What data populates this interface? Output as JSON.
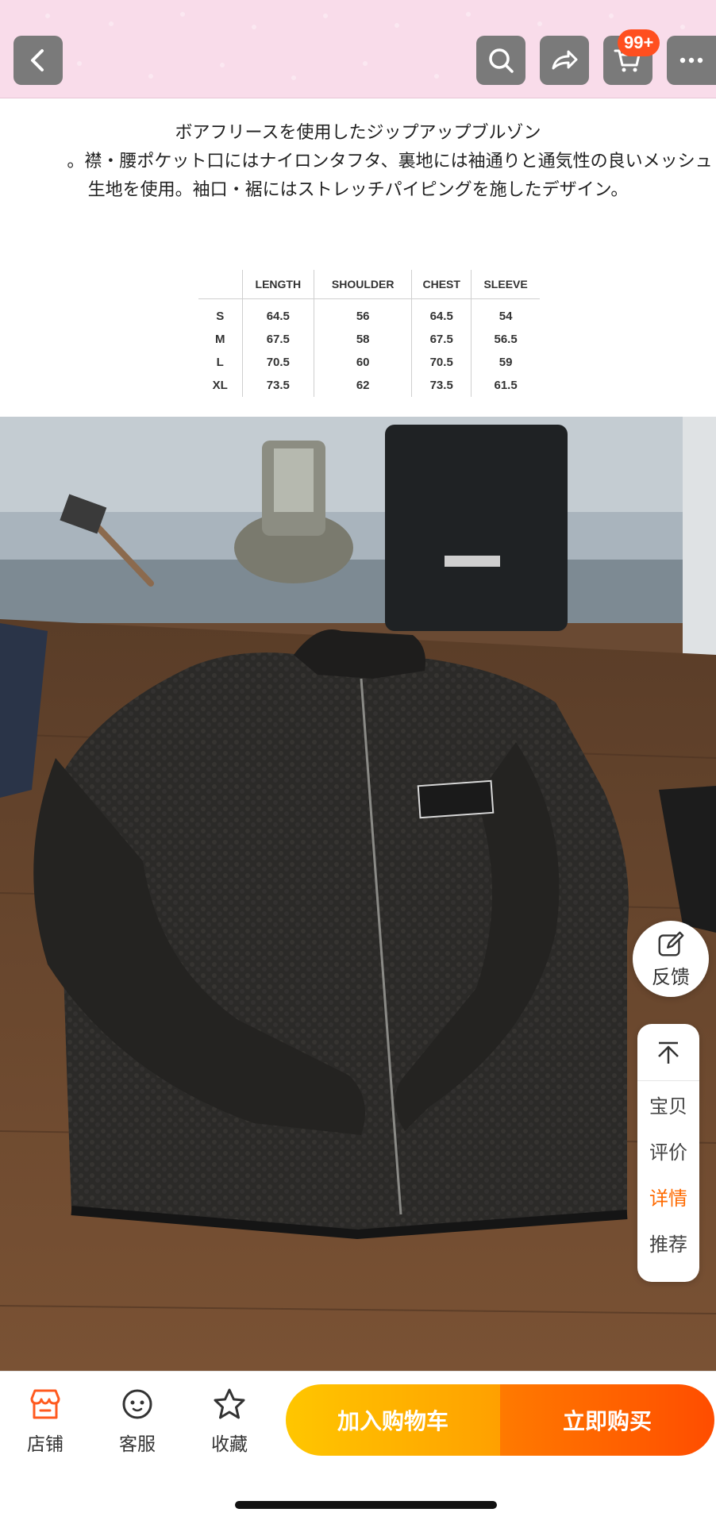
{
  "header": {
    "back_icon": "chevron-left-icon",
    "search_icon": "search-icon",
    "share_icon": "share-icon",
    "cart_icon": "cart-icon",
    "cart_badge": "99+",
    "more_icon": "more-icon"
  },
  "description": {
    "line1": "ボアフリースを使用したジップアップブルゾン",
    "line2": "。襟・腰ポケット口にはナイロンタフタ、裏地には袖通りと通気性の良いメッシュ",
    "line3": "生地を使用。袖口・裾にはストレッチパイピングを施したデザイン。"
  },
  "size_table": {
    "headers": [
      "",
      "LENGTH",
      "SHOULDER",
      "CHEST",
      "SLEEVE"
    ],
    "rows": [
      [
        "S",
        "64.5",
        "56",
        "64.5",
        "54"
      ],
      [
        "M",
        "67.5",
        "58",
        "67.5",
        "56.5"
      ],
      [
        "L",
        "70.5",
        "60",
        "70.5",
        "59"
      ],
      [
        "XL",
        "73.5",
        "62",
        "73.5",
        "61.5"
      ]
    ]
  },
  "photo": {
    "subject": "black boa fleece zip-up jacket on wooden table"
  },
  "floating": {
    "feedback_label": "反馈",
    "feedback_icon": "edit-icon",
    "top_icon": "back-to-top-icon",
    "nav_items": [
      "宝贝",
      "评价",
      "详情",
      "推荐"
    ],
    "active_item": "详情"
  },
  "bottom_bar": {
    "shop_label": "店铺",
    "service_label": "客服",
    "favorite_label": "收藏",
    "add_cart_label": "加入购物车",
    "buy_now_label": "立即购买",
    "accent_colors": [
      "#ffc600",
      "#ff4d00"
    ]
  }
}
